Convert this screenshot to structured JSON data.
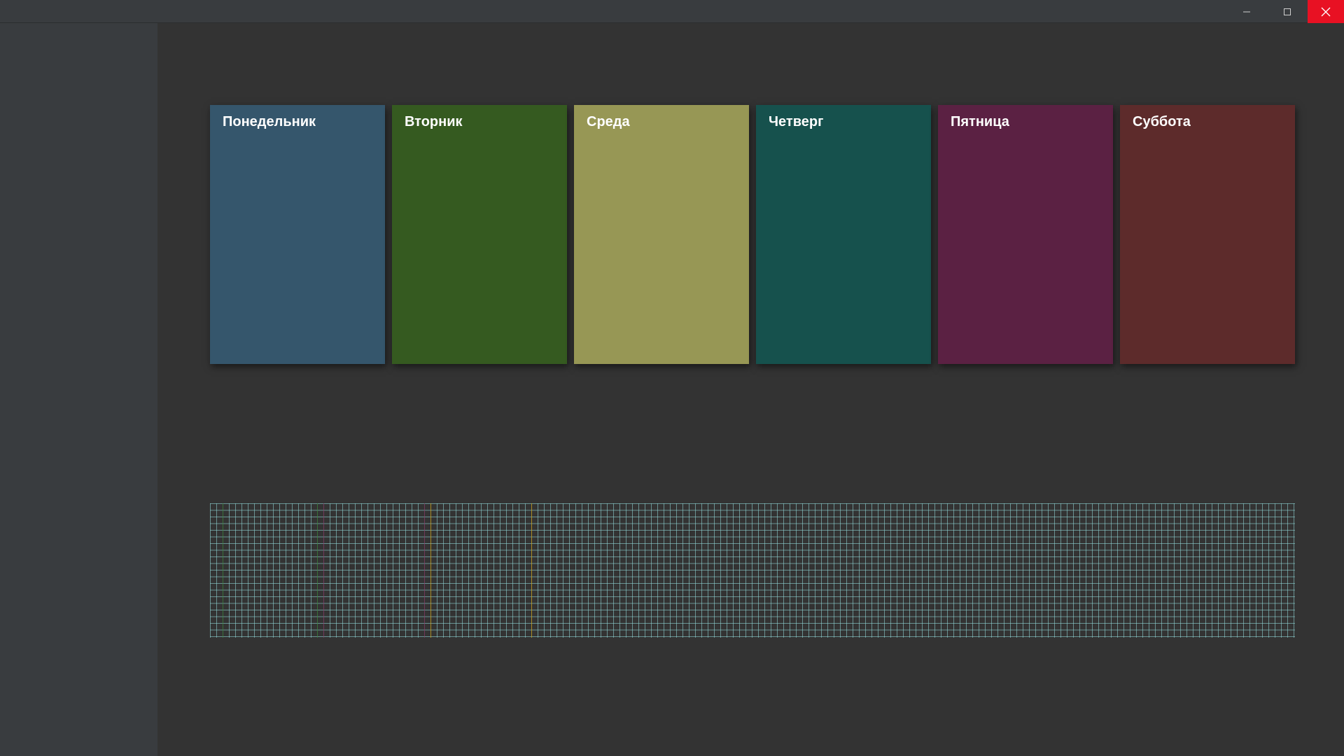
{
  "window": {
    "controls": {
      "minimize_icon": "minimize-icon",
      "maximize_icon": "maximize-icon",
      "close_icon": "close-icon"
    },
    "close_color": "#e81123"
  },
  "days": [
    {
      "label": "Понедельник",
      "color": "#35566c"
    },
    {
      "label": "Вторник",
      "color": "#355a20"
    },
    {
      "label": "Среда",
      "color": "#979755"
    },
    {
      "label": "Четверг",
      "color": "#16514d"
    },
    {
      "label": "Пятница",
      "color": "#5b2143"
    },
    {
      "label": "Суббота",
      "color": "#5d2b2b"
    }
  ],
  "grid": {
    "line_color": "#8fd3d3",
    "accent_colors": [
      "#3d8a3d",
      "#8a3d6a",
      "#c8a020"
    ]
  }
}
